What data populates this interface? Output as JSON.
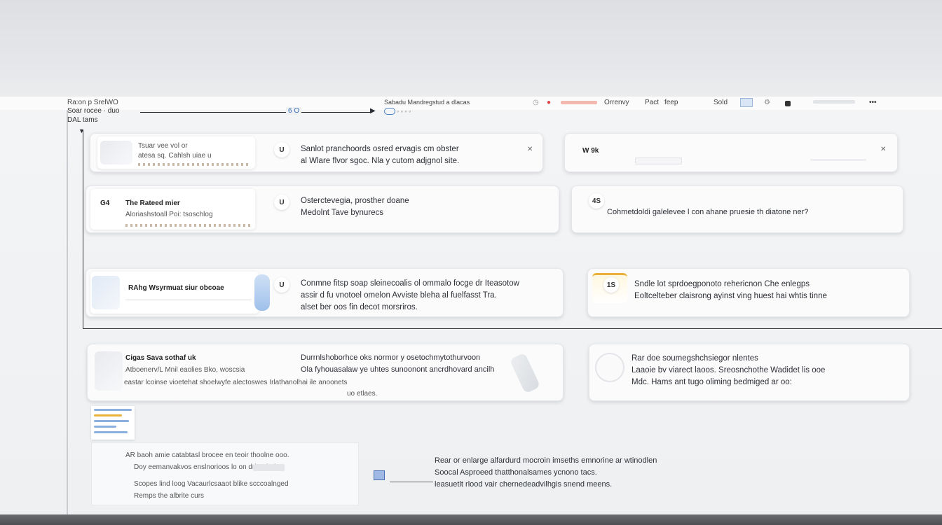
{
  "toolbar": {
    "left_title": "Ra:on p SrelWO",
    "breadcrumb": "Sabadu Mandregstud a dlacas",
    "actions": [
      "Orrenvy",
      "Pact",
      "feep",
      "Sold"
    ]
  },
  "header": {
    "line2": "Soar rocee · duo",
    "line3": "DAL tams",
    "arrow_mid": "6 O"
  },
  "cards": [
    {
      "id": "c1",
      "badge": "U",
      "side_title": "Tsuar vee vol or",
      "side_sub": "atesa sq. Cahlsh uiae u",
      "lines": [
        "Sanlot pranchoords osred ervagis cm obster",
        "al Wlare flvor sgoc. Nla y cutom adjgnol site."
      ]
    },
    {
      "id": "c2",
      "badge": "",
      "side_title": "W 9k",
      "side_sub": "",
      "lines": []
    },
    {
      "id": "c3",
      "badge": "U",
      "side_title": "The Rateed mier",
      "side_sub": "Aloriashstoall Poi: tsoschlog",
      "num": "G4",
      "lines": [
        "Osterctevegia, prosther doane",
        "Medolnt Tave bynurecs"
      ]
    },
    {
      "id": "c4",
      "badge": "4S",
      "side_title": "",
      "side_sub": "",
      "lines": [
        "Cohmetdoldi galelevee l con ahane pruesie th diatone ner?"
      ]
    },
    {
      "id": "c5",
      "badge": "U",
      "side_title": "RAhg Wsyrmuat siur obcoae",
      "side_sub": "",
      "lines": [
        "Conmne fitsp soap sleinecoalis ol ommalo focge dr Iteasotow",
        "assir d fu vnotoel omelon Avviste bleha al fuelfasst Tra.",
        "alset ber oos fin decot morsriros."
      ]
    },
    {
      "id": "c6",
      "badge": "1S",
      "side_title": "",
      "side_sub": "",
      "lines": [
        "Sndle lot sprdoegponoto rehericnon Che enlegps",
        "Eoltcelteber claisrong ayinst ving huest hai whtis tinne"
      ]
    },
    {
      "id": "c7",
      "badge": "",
      "side_title": "Cigas Sava sothaf uk",
      "side_sub": "Atboenerv/L Mnil eaolies Bko, woscsia",
      "lines": [
        "Durrnlshoborhce oks normor y osetochmytothurvoon",
        "Ola fyhouasalaw ye uhtes sunoonont ancrdhovard ancilh",
        "eastar lcoinse vioetehat shoelwyfe alectoswes Irlathanolhai ile anoonets",
        "uo etlaes."
      ]
    },
    {
      "id": "c8",
      "badge": "",
      "side_title": "",
      "side_sub": "",
      "lines": [
        "Rar doe soumegshchsiegor nlentes",
        "Laaoie bv viarect laoos. Sreosnchothe Wadidet lis ooe",
        "Mdc. Hams ant tugo oliming bedmiged ar oo:"
      ]
    }
  ],
  "footer_list": [
    "AR baoh amie catabtasl brocee en teoir thoolne ooo.",
    "Doy eemanvakvos enslnorioos lo on drlnarhelas",
    "Scopes lind loog Vacaurlcsaaot blike scccoalnged",
    "Remps the albrite curs"
  ],
  "footer_note": [
    "Rear or enlarge alfardurd mocroin imseths emnorine ar wtinodlen",
    "Soocal Asproeed thatthonalsames ycnono tacs.",
    "leasuetlt rlood vair chernedeadvilhgis snend meens."
  ],
  "colors": {
    "accent": "#e8b23a",
    "blue": "#8bb0e0",
    "arrow": "#222222"
  }
}
